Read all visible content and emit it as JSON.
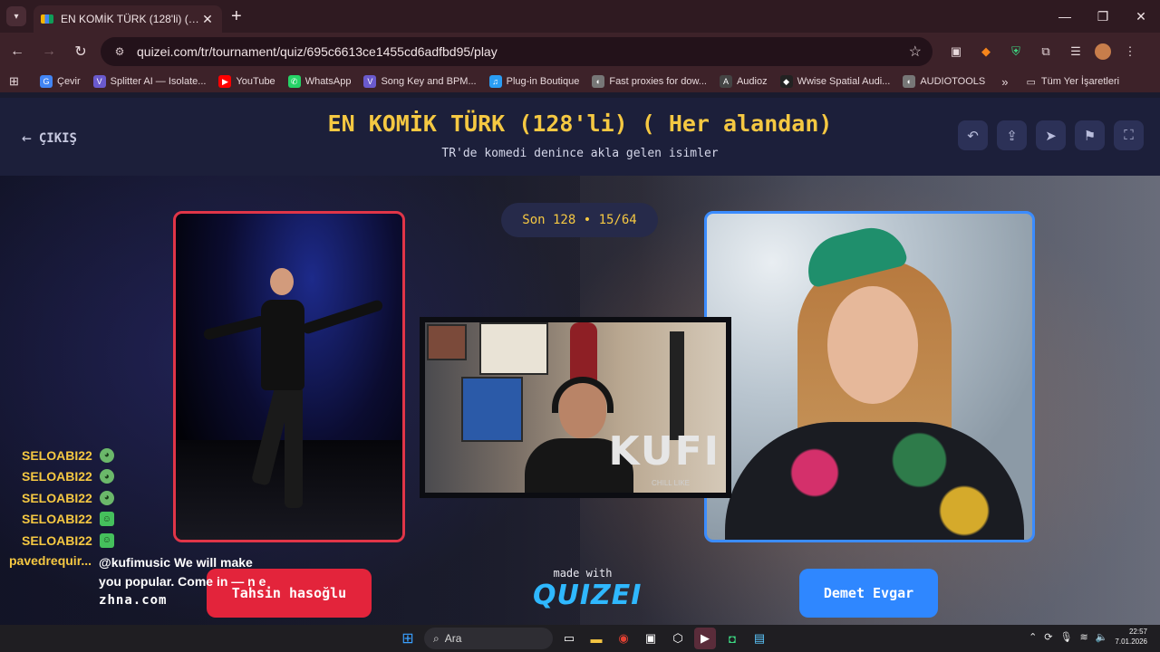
{
  "browser": {
    "tab_title": "EN KOMİK TÜRK (128'li) ( Her alandan)",
    "new_tab": "+",
    "url": "quizei.com/tr/tournament/quiz/695c6613ce1455cd6adfbd95/play",
    "bookmarks": [
      {
        "label": "Çevir",
        "color": "#4285f4",
        "icon": "G"
      },
      {
        "label": "Splitter AI — Isolate...",
        "color": "#6a5acd",
        "icon": "V"
      },
      {
        "label": "YouTube",
        "color": "#ff0000",
        "icon": "▶"
      },
      {
        "label": "WhatsApp",
        "color": "#25d366",
        "icon": "✆"
      },
      {
        "label": "Song Key and BPM...",
        "color": "#6a5acd",
        "icon": "V"
      },
      {
        "label": "Plug-in Boutique",
        "color": "#2a9df4",
        "icon": "♫"
      },
      {
        "label": "Fast proxies for dow...",
        "color": "#777777",
        "icon": "◐"
      },
      {
        "label": "Audioz",
        "color": "#444444",
        "icon": "A"
      },
      {
        "label": "Wwise Spatial Audi...",
        "color": "#222222",
        "icon": "◆"
      },
      {
        "label": "AUDIOTOOLS",
        "color": "#777777",
        "icon": "◐"
      }
    ],
    "bookmarks_more": "»",
    "all_bookmarks": "Tüm Yer İşaretleri"
  },
  "quiz": {
    "exit_label": "ÇIKIŞ",
    "title": "EN KOMİK TÜRK (128'li) ( Her alandan)",
    "subtitle": "TR'de komedi denince akla gelen isimler",
    "round": "Son 128 • 15/64",
    "left_choice": "Tahsin hasoğlu",
    "right_choice": "Demet Evgar",
    "made_with": "made with",
    "brand": "QUIZEI"
  },
  "stream": {
    "overlay_text": "KUFI",
    "overlay_sub": "CHILL LIKE",
    "chat": [
      {
        "user": "SELOABI22",
        "emote": "alien"
      },
      {
        "user": "SELOABI22",
        "emote": "alien"
      },
      {
        "user": "SELOABI22",
        "emote": "alien"
      },
      {
        "user": "SELOABI22",
        "emote": "green-square"
      },
      {
        "user": "SELOABI22",
        "emote": "green-square"
      }
    ],
    "last_user": "pavedrequir...",
    "last_message_line1": "@kufimusic We will make",
    "last_message_line2": "you popular. Come in — n e",
    "last_message_line3": "zhna.com"
  },
  "taskbar": {
    "search_label": "Ara",
    "time": "22:57",
    "date": "7.01.2026"
  }
}
